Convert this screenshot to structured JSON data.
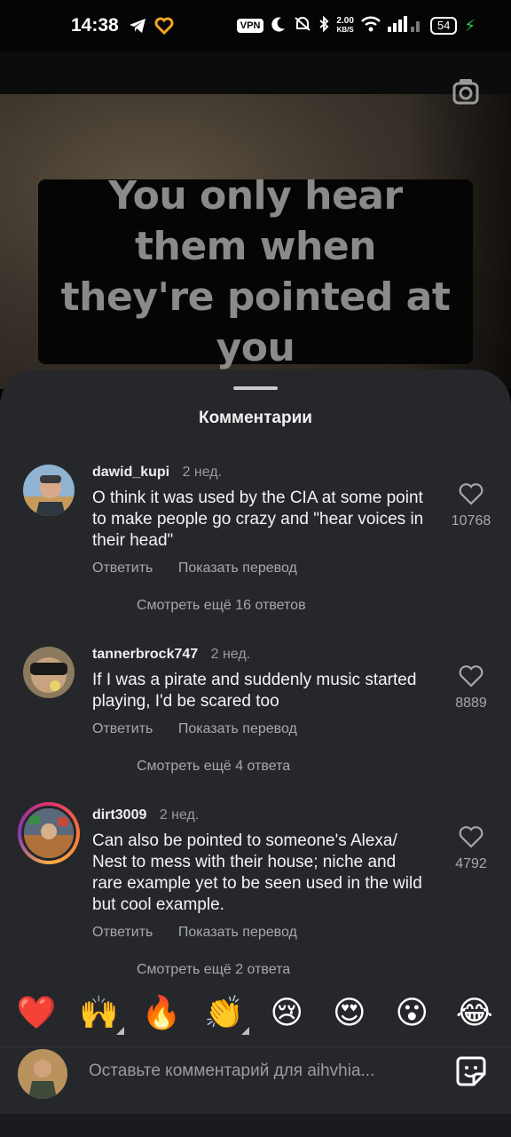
{
  "status_bar": {
    "time": "14:38",
    "vpn": "VPN",
    "speed_value": "2.00",
    "speed_unit": "KB/S",
    "battery": "54"
  },
  "video": {
    "caption": "You only hear them when they're pointed at you"
  },
  "sheet": {
    "title": "Комментарии"
  },
  "comments": [
    {
      "username": "dawid_kupi",
      "time": "2 нед.",
      "text": "O think it was used by the CIA at some point to make people go crazy and \"hear voices in their head\"",
      "reply": "Ответить",
      "translate": "Показать перевод",
      "more_replies": "Смотреть ещё 16 ответов",
      "likes": "10768"
    },
    {
      "username": "tannerbrock747",
      "time": "2 нед.",
      "text": "If I was a pirate and suddenly music started playing, I'd be scared too",
      "reply": "Ответить",
      "translate": "Показать перевод",
      "more_replies": "Смотреть ещё 4 ответа",
      "likes": "8889"
    },
    {
      "username": "dirt3009",
      "time": "2 нед.",
      "text": "Can also be pointed to someone's Alexa/ Nest to mess with their house; niche and rare example yet to be seen used in the wild but cool example.",
      "reply": "Ответить",
      "translate": "Показать перевод",
      "more_replies": "Смотреть ещё 2 ответа",
      "likes": "4792"
    }
  ],
  "emojis": [
    {
      "name": "red-heart",
      "glyph": "❤️"
    },
    {
      "name": "raising-hands",
      "glyph": "🙌"
    },
    {
      "name": "fire",
      "glyph": "🔥"
    },
    {
      "name": "clapping-hands",
      "glyph": "👏"
    },
    {
      "name": "crying-face",
      "glyph": "😢"
    },
    {
      "name": "heart-eyes",
      "glyph": "😍"
    },
    {
      "name": "surprised-face",
      "glyph": "😮"
    },
    {
      "name": "tears-of-joy",
      "glyph": "😂"
    }
  ],
  "input": {
    "placeholder": "Оставьте комментарий для aihvhia..."
  },
  "colors": {
    "sheet_bg": "#25272b",
    "accent_charge": "#30d158"
  }
}
